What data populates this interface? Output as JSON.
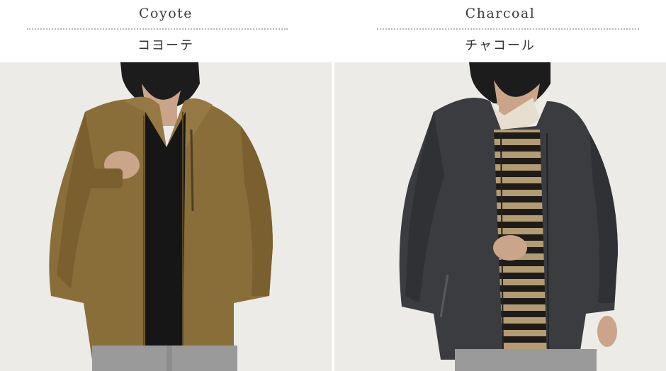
{
  "variants": [
    {
      "name_en": "Coyote",
      "name_jp": "コヨーテ",
      "jacket_color": "#8a6e3a",
      "inner_color": "#1a1a1a",
      "photo_icon": "coyote-jacket-photo"
    },
    {
      "name_en": "Charcoal",
      "name_jp": "チャコール",
      "jacket_color": "#3a3c3f",
      "inner_color": "#2a2622",
      "photo_icon": "charcoal-jacket-photo"
    }
  ],
  "colors": {
    "background": "#ffffff",
    "photo_backdrop": "#ececea",
    "divider_dots": "#b8b8b8"
  }
}
